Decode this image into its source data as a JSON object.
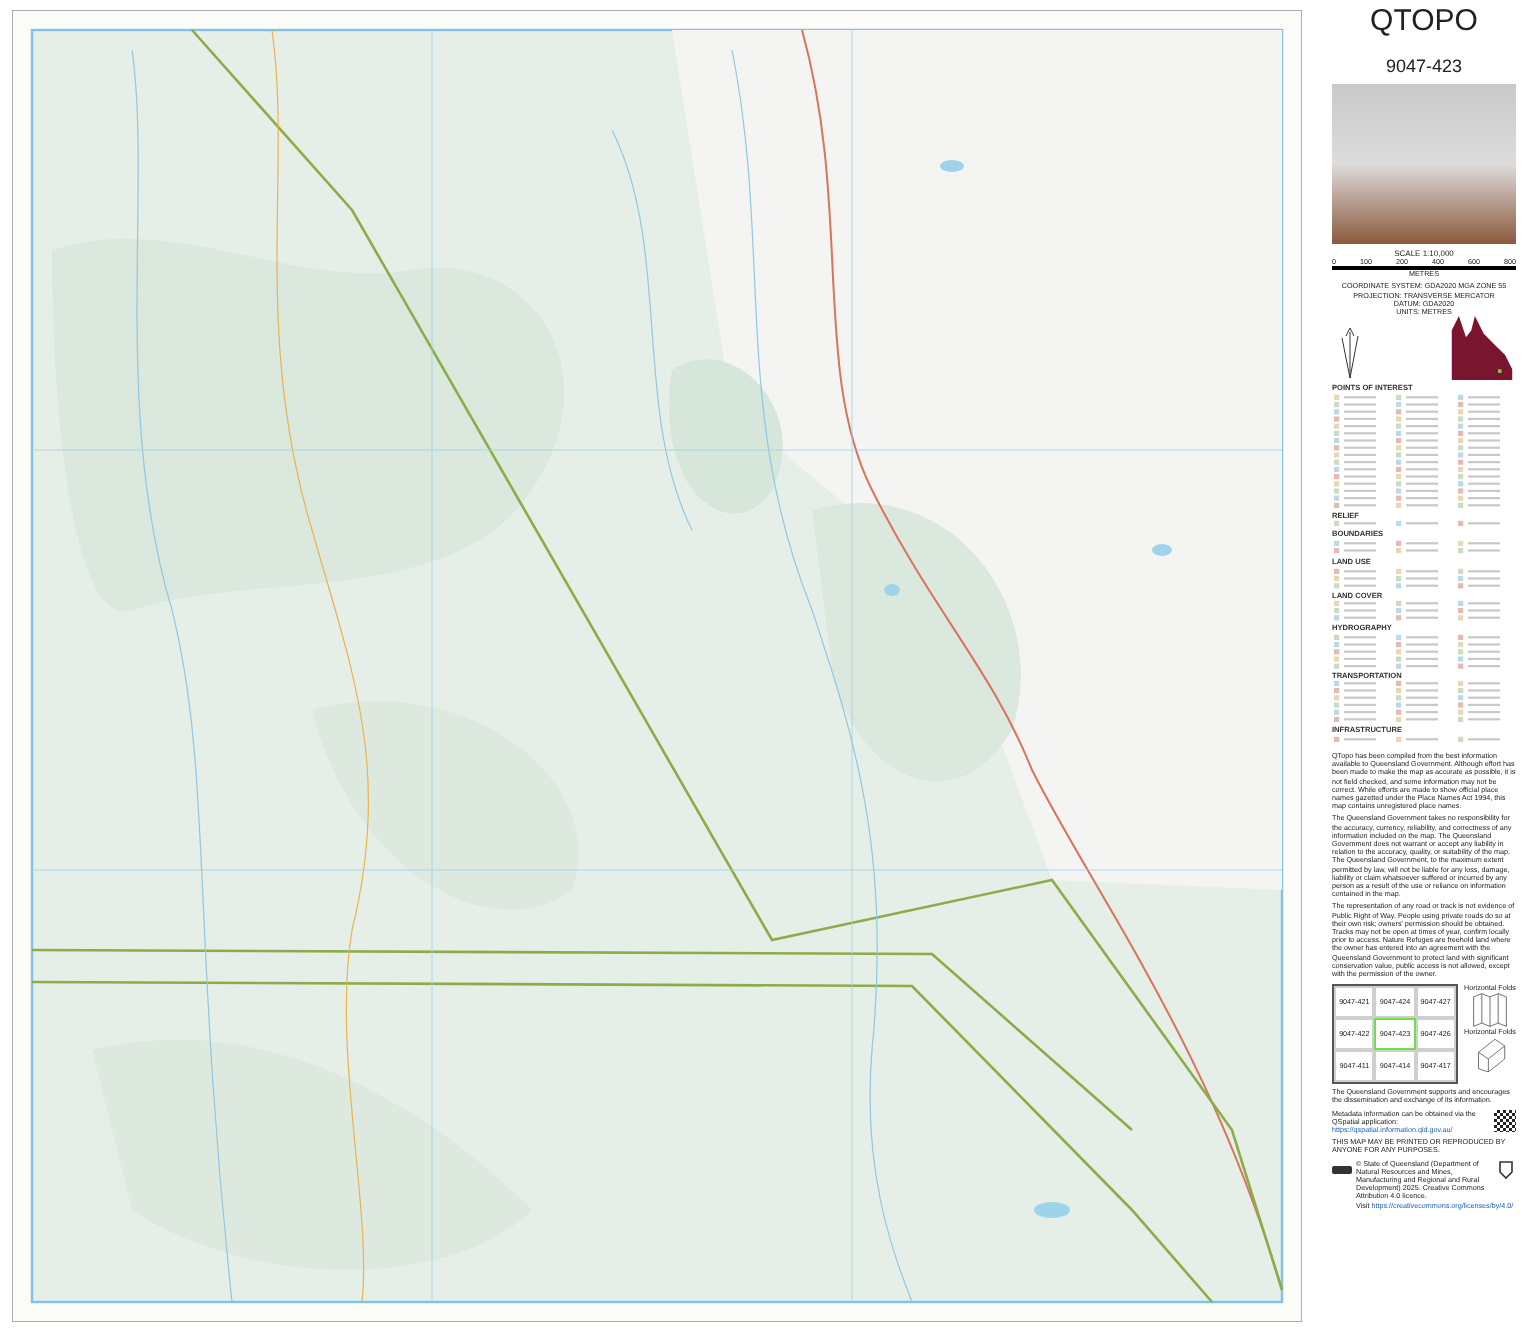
{
  "title": "QTOPO",
  "sheet_number": "9047-423",
  "scale": {
    "label": "SCALE 1:10,000",
    "ticks": [
      "0",
      "100",
      "200",
      "400",
      "600",
      "800"
    ],
    "unit": "METRES"
  },
  "projection": [
    "COORDINATE SYSTEM: GDA2020 MGA ZONE 55",
    "PROJECTION: TRANSVERSE MERCATOR",
    "DATUM: GDA2020",
    "UNITS: METRES"
  ],
  "legend": [
    {
      "heading": "POINTS OF INTEREST"
    },
    {
      "heading": "RELIEF"
    },
    {
      "heading": "BOUNDARIES"
    },
    {
      "heading": "LAND USE"
    },
    {
      "heading": "LAND COVER"
    },
    {
      "heading": "HYDROGRAPHY"
    },
    {
      "heading": "TRANSPORTATION"
    },
    {
      "heading": "INFRASTRUCTURE"
    }
  ],
  "notes": [
    "QTopo has been compiled from the best information available to Queensland Government. Although effort has been made to make the map as accurate as possible, it is not field checked, and some information may not be correct. While efforts are made to show official place names gazetted under the Place Names Act 1994, this map contains unregistered place names.",
    "The Queensland Government takes no responsibility for the accuracy, currency, reliability, and correctness of any information included on the map. The Queensland Government does not warrant or accept any liability in relation to the accuracy, quality, or suitability of the map. The Queensland Government, to the maximum extent permitted by law, will not be liable for any loss, damage, liability or claim whatsoever suffered or incurred by any person as a result of the use or reliance on information contained in the map.",
    "The representation of any road or track is not evidence of Public Right of Way. People using private roads do so at their own risk; owners' permission should be obtained. Tracks may not be open at times of year, confirm locally prior to access. Nature Refuges are freehold land where the owner has entered into an agreement with the Queensland Government to protect land with significant conservation value, public access is not allowed, except with the permission of the owner."
  ],
  "sheet_index": [
    {
      "label": "9047-421",
      "selected": false
    },
    {
      "label": "9047-424",
      "selected": false
    },
    {
      "label": "9047-427",
      "selected": false
    },
    {
      "label": "9047-422",
      "selected": false
    },
    {
      "label": "9047-423",
      "selected": true
    },
    {
      "label": "9047-426",
      "selected": false
    },
    {
      "label": "9047-411",
      "selected": false
    },
    {
      "label": "9047-414",
      "selected": false
    },
    {
      "label": "9047-417",
      "selected": false
    }
  ],
  "fold_labels": [
    "Horizontal Folds",
    "Horizontal Folds"
  ],
  "support_note": "The Queensland Government supports and encourages the dissemination and exchange of its information.",
  "metadata_note": "Metadata information can be obtained via the QSpatial application:",
  "metadata_link": "https://qspatial.information.qld.gov.au/",
  "reproduction_note": "THIS MAP MAY BE PRINTED OR REPRODUCED BY ANYONE FOR ANY PURPOSES.",
  "copyright": "© State of Queensland (Department of Natural Resources and Mines, Manufacturing and Regional and Rural Development) 2025. Creative Commons Attribution 4.0 licence.",
  "copyright_link_label": "Visit",
  "copyright_link": "https://creativecommons.org/licenses/by/4.0/"
}
